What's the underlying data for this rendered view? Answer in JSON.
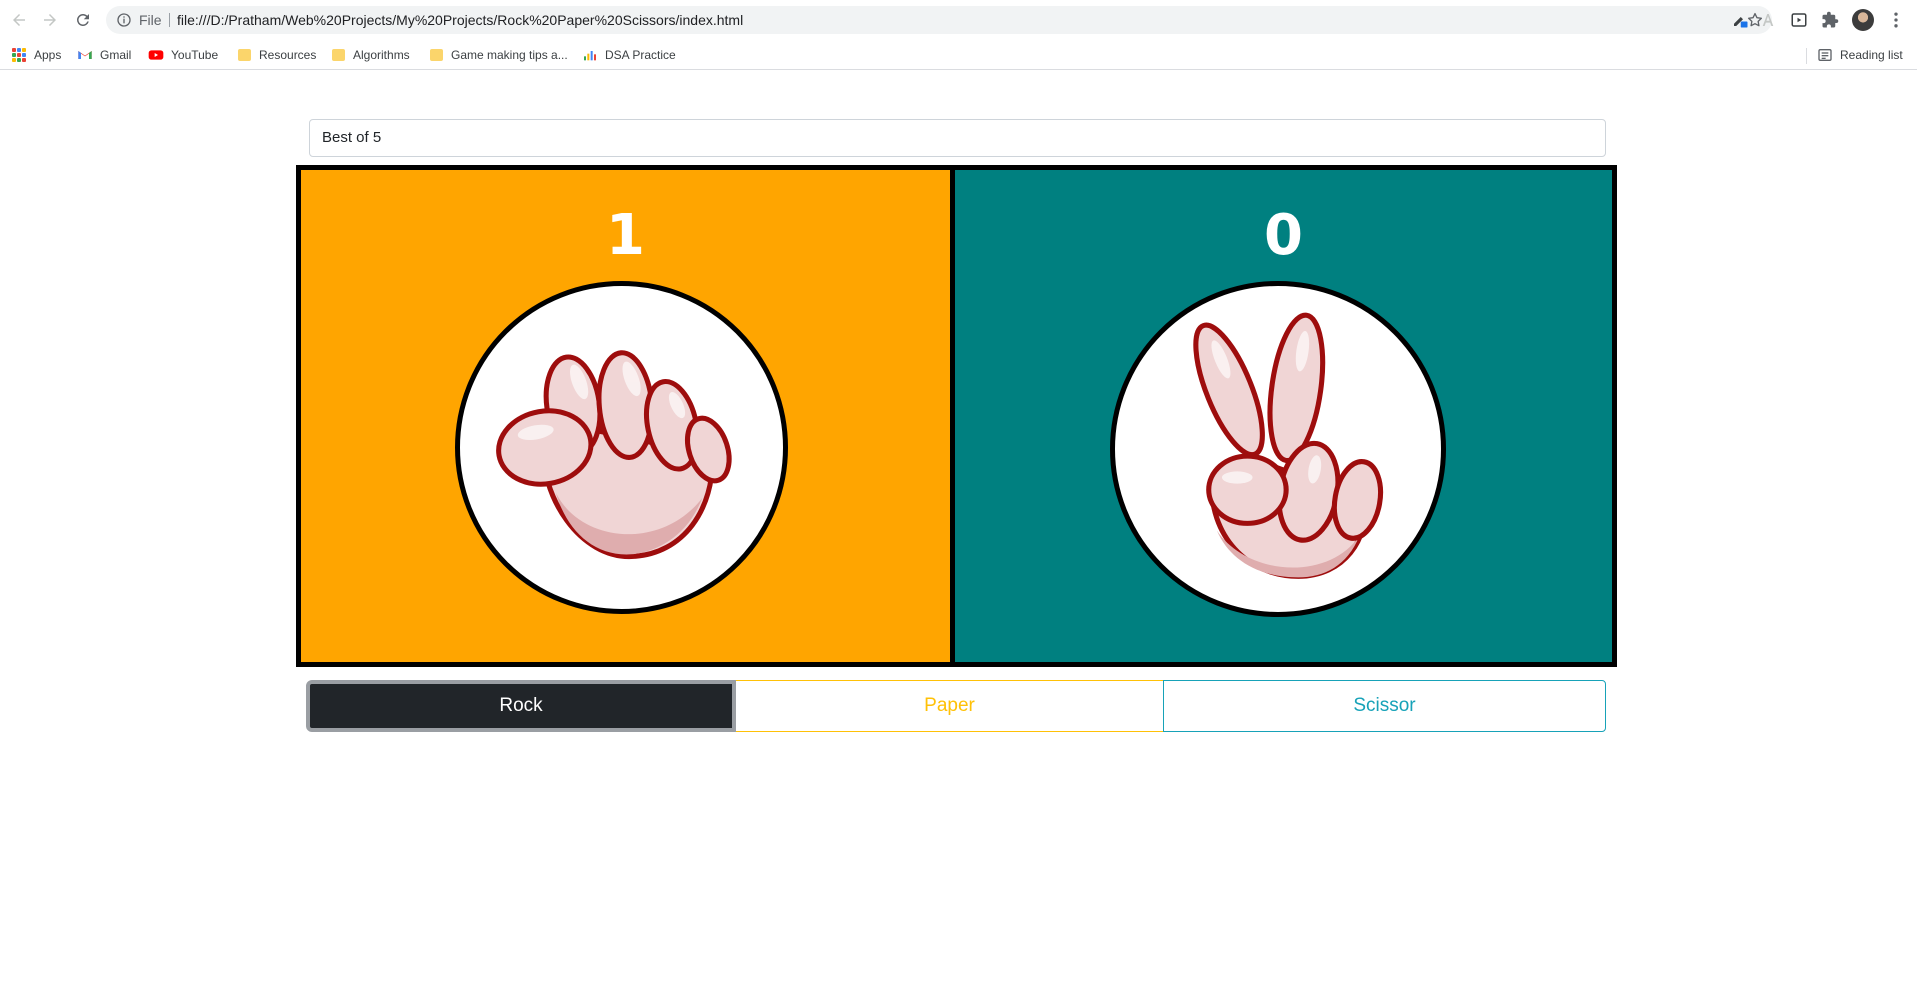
{
  "browser": {
    "omnibox": {
      "scheme_label": "File",
      "url": "file:///D:/Pratham/Web%20Projects/My%20Projects/Rock%20Paper%20Scissors/index.html"
    },
    "bookmarks": [
      {
        "label": "Apps",
        "icon": "apps-grid-icon"
      },
      {
        "label": "Gmail",
        "icon": "gmail-icon"
      },
      {
        "label": "YouTube",
        "icon": "youtube-icon"
      },
      {
        "label": "Resources",
        "icon": "folder-icon"
      },
      {
        "label": "Algorithms",
        "icon": "folder-icon"
      },
      {
        "label": "Game making tips a...",
        "icon": "folder-icon"
      },
      {
        "label": "DSA Practice",
        "icon": "chart-icon"
      }
    ],
    "reading_list": "Reading list"
  },
  "game": {
    "mode_value": "Best of 5",
    "player": {
      "score": "1",
      "hand": "rock",
      "panel_color": "#ffa500"
    },
    "computer": {
      "score": "0",
      "hand": "scissors",
      "panel_color": "#008080"
    },
    "choices": {
      "rock": "Rock",
      "paper": "Paper",
      "scissor": "Scissor"
    }
  },
  "colors": {
    "accent_warning": "#ffc107",
    "accent_info": "#17a2b8",
    "dark": "#212529",
    "hand_outline": "#9e0d0d",
    "hand_fill": "#f0d5d5"
  }
}
